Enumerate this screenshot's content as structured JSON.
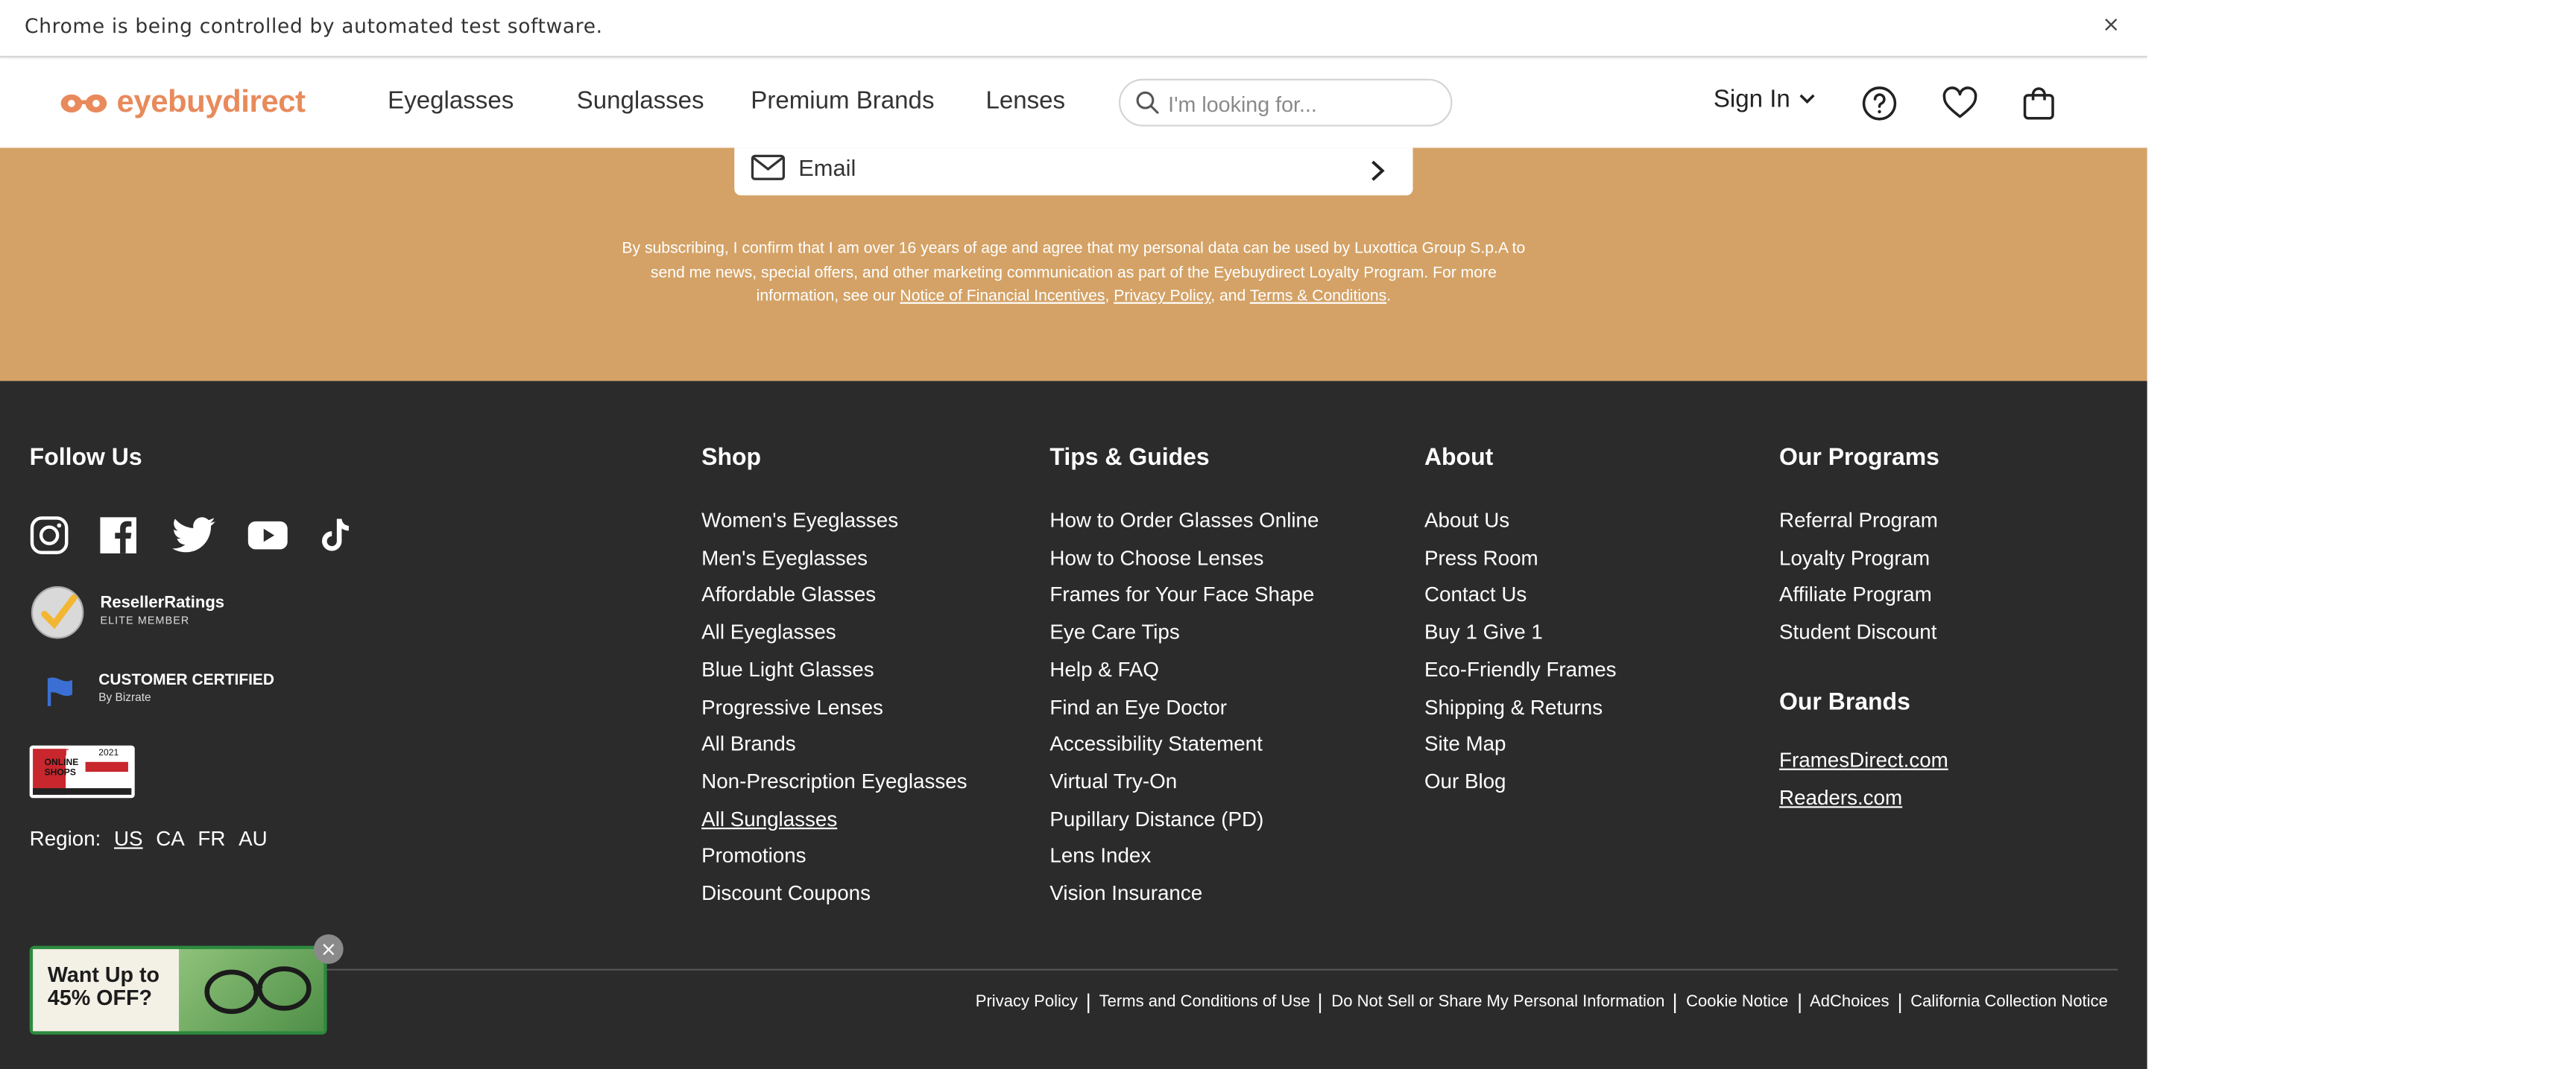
{
  "chrome_bar": {
    "message": "Chrome is being controlled by automated test software.",
    "close_label": "×"
  },
  "header": {
    "logo_text": "eyebuydirect",
    "nav": [
      "Eyeglasses",
      "Sunglasses",
      "Premium Brands",
      "Lenses"
    ],
    "search_placeholder": "I'm looking for...",
    "sign_in": "Sign In",
    "icons": [
      "help-icon",
      "heart-icon",
      "bag-icon"
    ]
  },
  "subscribe": {
    "email_label": "Email",
    "legal_text": "By subscribing, I confirm that I am over 16 years of age and agree that my personal data can be used by Luxottica Group S.p.A to send me news, special offers, and other marketing communication as part of the Eyebuydirect Loyalty Program. For more information, see our ",
    "link_financial": "Notice of Financial Incentives",
    "sep1": ", ",
    "link_privacy": "Privacy Policy",
    "sep2": ", and ",
    "link_terms": "Terms & Conditions",
    "end": "."
  },
  "footer": {
    "follow_us": "Follow Us",
    "social": [
      "instagram-icon",
      "facebook-icon",
      "twitter-icon",
      "youtube-icon",
      "tiktok-icon"
    ],
    "reseller_line1": "ResellerRatings",
    "reseller_line2": "ELITE MEMBER",
    "customer_line1": "CUSTOMER CERTIFIED",
    "customer_line2": "By Bizrate",
    "best_shops_line1": "BEST",
    "best_shops_line2": "ONLINE",
    "best_shops_line3": "SHOPS",
    "best_shops_year": "2021",
    "region_label": "Region:",
    "regions": [
      "US",
      "CA",
      "FR",
      "AU"
    ],
    "shop": {
      "title": "Shop",
      "items": [
        "Women's Eyeglasses",
        "Men's Eyeglasses",
        "Affordable Glasses",
        "All Eyeglasses",
        "Blue Light Glasses",
        "Progressive Lenses",
        "All Brands",
        "Non-Prescription Eyeglasses",
        "All Sunglasses",
        "Promotions",
        "Discount Coupons"
      ]
    },
    "tips": {
      "title": "Tips & Guides",
      "items": [
        "How to Order Glasses Online",
        "How to Choose Lenses",
        "Frames for Your Face Shape",
        "Eye Care Tips",
        "Help & FAQ",
        "Find an Eye Doctor",
        "Accessibility Statement",
        "Virtual Try-On",
        "Pupillary Distance (PD)",
        "Lens Index",
        "Vision Insurance"
      ]
    },
    "about": {
      "title": "About",
      "items": [
        "About Us",
        "Press Room",
        "Contact Us",
        "Buy 1 Give 1",
        "Eco-Friendly Frames",
        "Shipping & Returns",
        "Site Map",
        "Our Blog"
      ]
    },
    "programs": {
      "title": "Our Programs",
      "items": [
        "Referral Program",
        "Loyalty Program",
        "Affiliate Program",
        "Student Discount"
      ]
    },
    "brands": {
      "title": "Our Brands",
      "items": [
        "FramesDirect.com",
        "Readers.com"
      ]
    },
    "bottom_links": [
      "Privacy Policy",
      "Terms and Conditions of Use",
      "Do Not Sell or Share My Personal Information",
      "Cookie Notice",
      "AdChoices",
      "California Collection Notice"
    ],
    "promo": {
      "line1": "Want Up to",
      "line2": "45% OFF?",
      "close": "×"
    }
  },
  "colors": {
    "brand_orange": "#e88a5b",
    "subscribe_bg": "#d4a266",
    "footer_bg": "#2b2b2b"
  }
}
